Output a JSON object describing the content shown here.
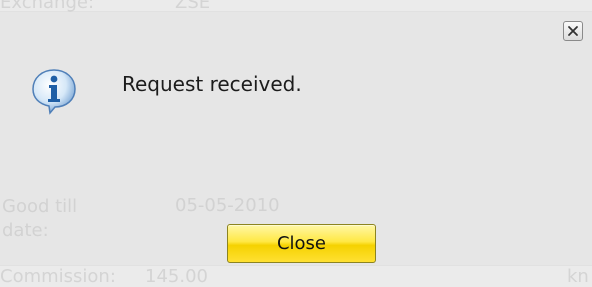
{
  "background": {
    "fields": [
      {
        "label": "Exchange:",
        "value": "ZSE"
      },
      {
        "label": "Good till date:",
        "value": "05-05-2010"
      },
      {
        "label": "Commission:",
        "value": "145.00",
        "unit": "kn"
      }
    ]
  },
  "dialog": {
    "message": "Request received.",
    "close_button_label": "Close",
    "icon": "info-icon",
    "dismiss_icon": "close-icon"
  },
  "colors": {
    "dialog_bg": "#e6e6e6",
    "button_yellow": "#ffe844",
    "icon_blue": "#2f6fb5"
  }
}
